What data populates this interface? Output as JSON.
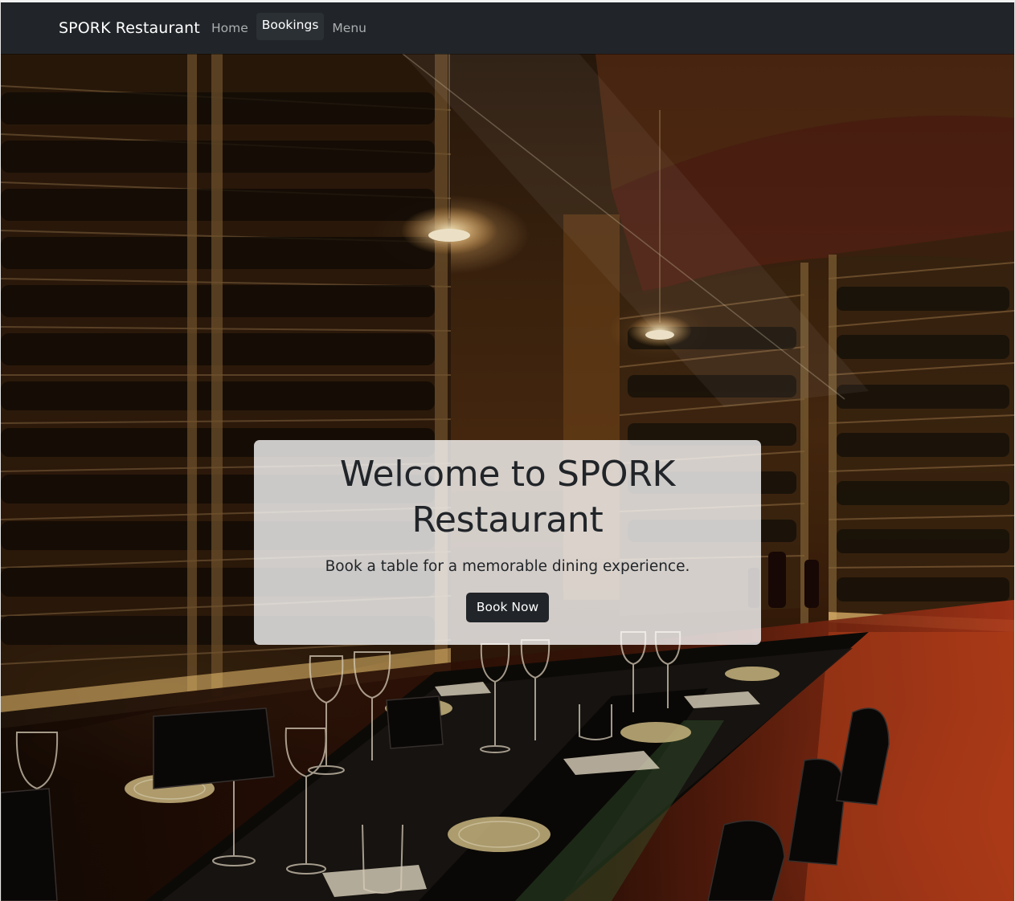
{
  "navbar": {
    "brand": "SPORK Restaurant",
    "links": [
      {
        "label": "Home",
        "active": false
      },
      {
        "label": "Bookings",
        "active": true
      },
      {
        "label": "Menu",
        "active": false
      }
    ],
    "background": "#212529"
  },
  "hero": {
    "title": "Welcome to SPORK Restaurant",
    "subtitle": "Book a table for a memorable dining experience.",
    "cta_label": "Book Now",
    "image_description": "wine-cellar-dining-room-photo"
  },
  "colors": {
    "dark": "#212529",
    "card_bg": "rgba(255,255,255,0.78)",
    "text": "#212529"
  }
}
